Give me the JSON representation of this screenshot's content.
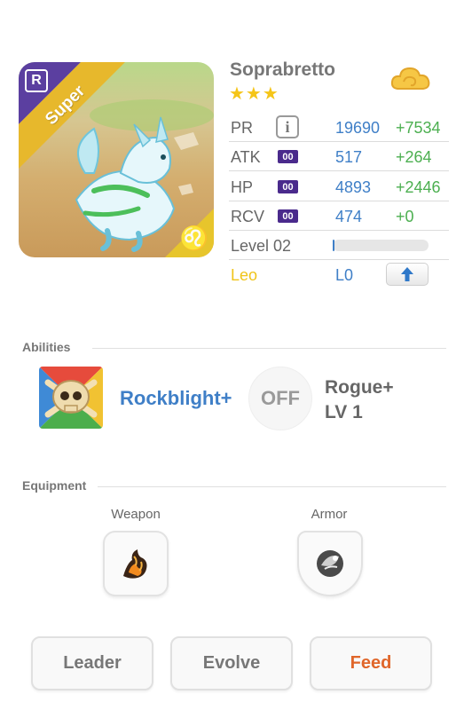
{
  "monster": {
    "name": "Soprabretto",
    "stars": "★★★",
    "rarity": "Super",
    "rank_badge": "R",
    "zodiac_symbol": "♌",
    "element_icon": "cloud-element-icon",
    "accent_purple": "#5b3fa0",
    "accent_gold": "#e7b82c"
  },
  "stats": [
    {
      "label": "PR",
      "value": "19690",
      "bonus": "+7534",
      "boost": null,
      "info": "i"
    },
    {
      "label": "ATK",
      "value": "517",
      "bonus": "+264",
      "boost": "00"
    },
    {
      "label": "HP",
      "value": "4893",
      "bonus": "+2446",
      "boost": "00"
    },
    {
      "label": "RCV",
      "value": "474",
      "bonus": "+0",
      "boost": "00"
    }
  ],
  "level": {
    "label": "Level 02",
    "progress": 0.02
  },
  "zodiac": {
    "label": "Leo",
    "level": "L0",
    "upgrade_icon": "arrow-up-icon"
  },
  "abilities": {
    "title": "Abilities",
    "primary": {
      "name": "Rockblight+",
      "icon": "skull-icon"
    },
    "secondary": {
      "status": "OFF",
      "name": "Rogue+",
      "level": "LV 1"
    }
  },
  "equipment": {
    "title": "Equipment",
    "weapon_label": "Weapon",
    "armor_label": "Armor"
  },
  "actions": {
    "leader": "Leader",
    "evolve": "Evolve",
    "feed": "Feed"
  },
  "colors": {
    "value_blue": "#3f7fc7",
    "bonus_green": "#4caf50",
    "zodiac_yellow": "#f0c419",
    "feed_orange": "#e0662a"
  }
}
